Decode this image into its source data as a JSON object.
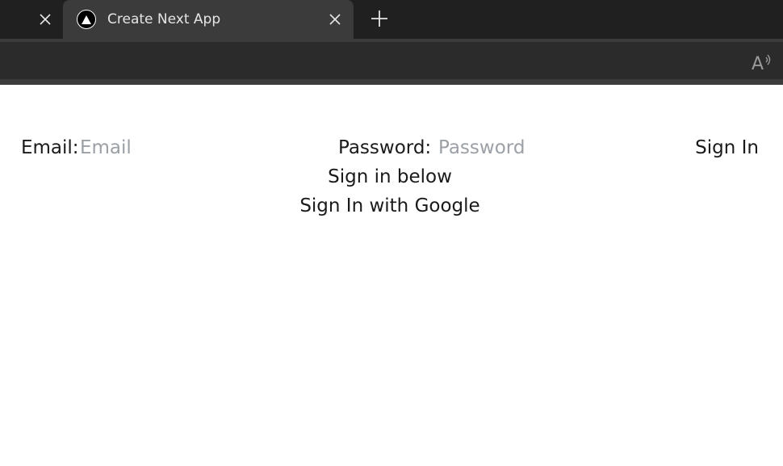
{
  "browser": {
    "tabs": [
      {
        "title": "",
        "active": false
      },
      {
        "title": "Create Next App",
        "active": true,
        "favicon": "nextjs-triangle-icon"
      }
    ],
    "new_tab_icon": "plus-icon",
    "read_aloud_icon": "read-aloud-icon",
    "colors": {
      "tabstrip": "#202020",
      "active_tab": "#3b3b3b",
      "toolbar": "#2b2b2b"
    }
  },
  "form": {
    "email_label": "Email:",
    "email_placeholder": "Email",
    "email_value": "",
    "password_label": "Password:",
    "password_placeholder": "Password",
    "password_value": "",
    "submit_label": "Sign In"
  },
  "below_text": "Sign in below",
  "google_button_label": "Sign In with Google"
}
